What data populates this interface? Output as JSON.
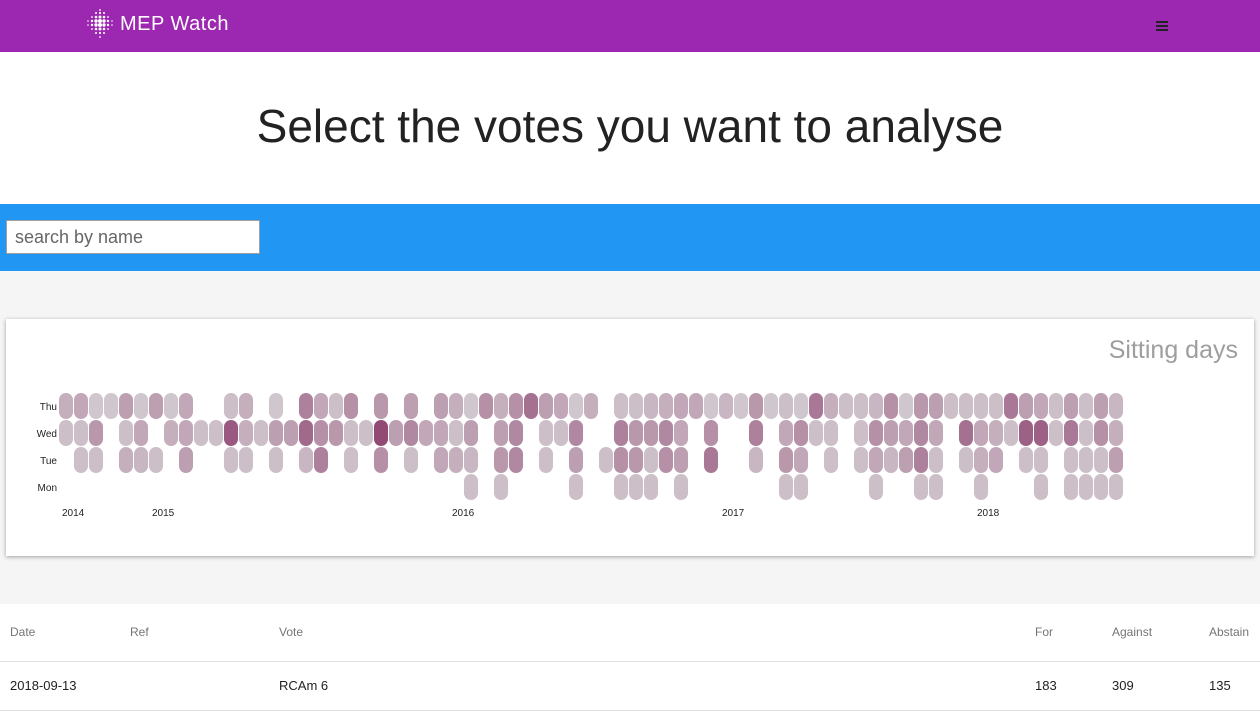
{
  "app": {
    "title": "MEP Watch",
    "logo_icon": "dotted-globe-icon",
    "menu_icon": "hamburger-menu-icon",
    "brand_color": "#9c27b0",
    "accent_color": "#2196f3"
  },
  "page": {
    "title": "Select the votes you want to analyse"
  },
  "search": {
    "placeholder": "search by name",
    "value": ""
  },
  "chart_data": {
    "type": "heatmap",
    "title": "Sitting days",
    "row_labels": [
      "Thu",
      "Wed",
      "Tue",
      "Mon"
    ],
    "year_labels": [
      {
        "label": "2014",
        "week": 0
      },
      {
        "label": "2015",
        "week": 6
      },
      {
        "label": "2016",
        "week": 26
      },
      {
        "label": "2017",
        "week": 44
      },
      {
        "label": "2018",
        "week": 61
      }
    ],
    "color_scale": {
      "low": "#d8d6d8",
      "high": "#8a3a6a"
    },
    "value_range": [
      0,
      1
    ],
    "weeks": 72,
    "days": {
      "Thu": [
        [
          0,
          0.25
        ],
        [
          1,
          0.3
        ],
        [
          2,
          0.1
        ],
        [
          3,
          0.1
        ],
        [
          4,
          0.35
        ],
        [
          5,
          0.1
        ],
        [
          6,
          0.35
        ],
        [
          7,
          0.1
        ],
        [
          8,
          0.3
        ],
        [
          11,
          0.15
        ],
        [
          12,
          0.25
        ],
        [
          14,
          0.1
        ],
        [
          16,
          0.55
        ],
        [
          17,
          0.3
        ],
        [
          18,
          0.15
        ],
        [
          19,
          0.45
        ],
        [
          21,
          0.4
        ],
        [
          23,
          0.35
        ],
        [
          25,
          0.35
        ],
        [
          26,
          0.25
        ],
        [
          27,
          0.1
        ],
        [
          28,
          0.45
        ],
        [
          29,
          0.25
        ],
        [
          30,
          0.45
        ],
        [
          31,
          0.65
        ],
        [
          32,
          0.35
        ],
        [
          33,
          0.3
        ],
        [
          34,
          0.1
        ],
        [
          35,
          0.25
        ],
        [
          37,
          0.15
        ],
        [
          38,
          0.15
        ],
        [
          39,
          0.2
        ],
        [
          40,
          0.25
        ],
        [
          41,
          0.3
        ],
        [
          42,
          0.3
        ],
        [
          43,
          0.1
        ],
        [
          44,
          0.2
        ],
        [
          45,
          0.1
        ],
        [
          46,
          0.4
        ],
        [
          47,
          0.1
        ],
        [
          48,
          0.15
        ],
        [
          49,
          0.1
        ],
        [
          50,
          0.6
        ],
        [
          51,
          0.25
        ],
        [
          52,
          0.15
        ],
        [
          53,
          0.15
        ],
        [
          54,
          0.2
        ],
        [
          55,
          0.45
        ],
        [
          56,
          0.1
        ],
        [
          57,
          0.4
        ],
        [
          58,
          0.35
        ],
        [
          59,
          0.15
        ],
        [
          60,
          0.15
        ],
        [
          61,
          0.15
        ],
        [
          62,
          0.15
        ],
        [
          63,
          0.6
        ],
        [
          64,
          0.35
        ],
        [
          65,
          0.3
        ],
        [
          66,
          0.15
        ],
        [
          67,
          0.35
        ],
        [
          68,
          0.15
        ],
        [
          69,
          0.35
        ],
        [
          70,
          0.2
        ]
      ],
      "Wed": [
        [
          0,
          0.15
        ],
        [
          1,
          0.15
        ],
        [
          2,
          0.4
        ],
        [
          4,
          0.15
        ],
        [
          5,
          0.3
        ],
        [
          7,
          0.25
        ],
        [
          8,
          0.3
        ],
        [
          9,
          0.15
        ],
        [
          10,
          0.15
        ],
        [
          11,
          0.8
        ],
        [
          12,
          0.25
        ],
        [
          13,
          0.15
        ],
        [
          14,
          0.35
        ],
        [
          15,
          0.35
        ],
        [
          16,
          0.7
        ],
        [
          17,
          0.45
        ],
        [
          18,
          0.4
        ],
        [
          19,
          0.15
        ],
        [
          20,
          0.15
        ],
        [
          21,
          0.9
        ],
        [
          22,
          0.35
        ],
        [
          23,
          0.5
        ],
        [
          24,
          0.3
        ],
        [
          25,
          0.3
        ],
        [
          26,
          0.15
        ],
        [
          27,
          0.35
        ],
        [
          29,
          0.35
        ],
        [
          30,
          0.5
        ],
        [
          32,
          0.15
        ],
        [
          33,
          0.15
        ],
        [
          34,
          0.5
        ],
        [
          37,
          0.55
        ],
        [
          38,
          0.4
        ],
        [
          39,
          0.4
        ],
        [
          40,
          0.5
        ],
        [
          41,
          0.3
        ],
        [
          43,
          0.45
        ],
        [
          46,
          0.55
        ],
        [
          48,
          0.3
        ],
        [
          49,
          0.45
        ],
        [
          50,
          0.15
        ],
        [
          51,
          0.15
        ],
        [
          53,
          0.15
        ],
        [
          54,
          0.45
        ],
        [
          55,
          0.35
        ],
        [
          56,
          0.3
        ],
        [
          57,
          0.5
        ],
        [
          58,
          0.3
        ],
        [
          60,
          0.65
        ],
        [
          61,
          0.3
        ],
        [
          62,
          0.25
        ],
        [
          63,
          0.15
        ],
        [
          64,
          0.75
        ],
        [
          65,
          0.75
        ],
        [
          66,
          0.15
        ],
        [
          67,
          0.6
        ],
        [
          68,
          0.15
        ],
        [
          69,
          0.45
        ],
        [
          70,
          0.25
        ]
      ],
      "Tue": [
        [
          1,
          0.15
        ],
        [
          2,
          0.15
        ],
        [
          4,
          0.25
        ],
        [
          5,
          0.2
        ],
        [
          6,
          0.15
        ],
        [
          8,
          0.35
        ],
        [
          11,
          0.15
        ],
        [
          12,
          0.15
        ],
        [
          14,
          0.15
        ],
        [
          16,
          0.2
        ],
        [
          17,
          0.55
        ],
        [
          19,
          0.15
        ],
        [
          21,
          0.45
        ],
        [
          23,
          0.15
        ],
        [
          25,
          0.3
        ],
        [
          26,
          0.25
        ],
        [
          27,
          0.2
        ],
        [
          29,
          0.4
        ],
        [
          30,
          0.5
        ],
        [
          32,
          0.15
        ],
        [
          34,
          0.35
        ],
        [
          36,
          0.15
        ],
        [
          37,
          0.45
        ],
        [
          38,
          0.4
        ],
        [
          39,
          0.15
        ],
        [
          40,
          0.45
        ],
        [
          41,
          0.35
        ],
        [
          43,
          0.6
        ],
        [
          46,
          0.2
        ],
        [
          48,
          0.4
        ],
        [
          49,
          0.3
        ],
        [
          51,
          0.15
        ],
        [
          53,
          0.15
        ],
        [
          54,
          0.3
        ],
        [
          55,
          0.2
        ],
        [
          56,
          0.35
        ],
        [
          57,
          0.55
        ],
        [
          58,
          0.15
        ],
        [
          60,
          0.15
        ],
        [
          61,
          0.25
        ],
        [
          62,
          0.3
        ],
        [
          64,
          0.15
        ],
        [
          65,
          0.15
        ],
        [
          67,
          0.15
        ],
        [
          68,
          0.15
        ],
        [
          69,
          0.15
        ],
        [
          70,
          0.35
        ]
      ],
      "Mon": [
        [
          27,
          0.15
        ],
        [
          29,
          0.15
        ],
        [
          34,
          0.15
        ],
        [
          37,
          0.15
        ],
        [
          38,
          0.15
        ],
        [
          39,
          0.15
        ],
        [
          41,
          0.15
        ],
        [
          48,
          0.15
        ],
        [
          49,
          0.15
        ],
        [
          54,
          0.15
        ],
        [
          57,
          0.15
        ],
        [
          58,
          0.15
        ],
        [
          61,
          0.15
        ],
        [
          65,
          0.15
        ],
        [
          67,
          0.15
        ],
        [
          68,
          0.15
        ],
        [
          69,
          0.15
        ],
        [
          70,
          0.15
        ]
      ]
    }
  },
  "table": {
    "headers": {
      "date": "Date",
      "ref": "Ref",
      "vote": "Vote",
      "for": "For",
      "against": "Against",
      "abstain": "Abstain"
    },
    "rows": [
      {
        "date": "2018-09-13",
        "ref": "",
        "vote": "RCAm 6",
        "for": "183",
        "against": "309",
        "abstain": "135"
      }
    ]
  }
}
